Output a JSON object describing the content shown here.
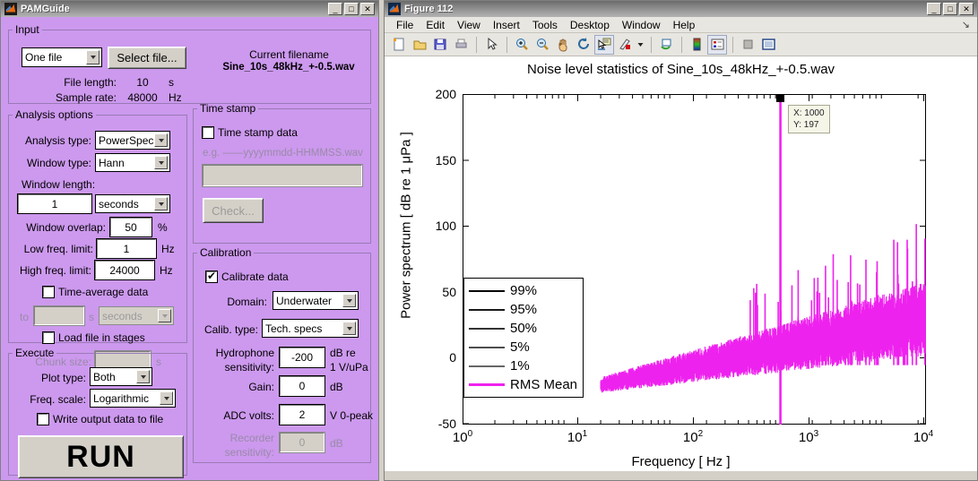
{
  "pamguide": {
    "title": "PAMGuide",
    "icon": "matlab-logo-icon",
    "window_buttons": {
      "minimize": "_",
      "maximize": "□",
      "close": "✕"
    },
    "input": {
      "legend": "Input",
      "file_mode": "One file",
      "select_button": "Select file...",
      "current_filename_label": "Current filename",
      "current_filename": "Sine_10s_48kHz_+-0.5.wav",
      "file_length_label": "File length:",
      "file_length_value": "10",
      "file_length_unit": "s",
      "sample_rate_label": "Sample rate:",
      "sample_rate_value": "48000",
      "sample_rate_unit": "Hz"
    },
    "analysis": {
      "legend": "Analysis options",
      "analysis_type_label": "Analysis type:",
      "analysis_type_value": "PowerSpec",
      "window_type_label": "Window type:",
      "window_type_value": "Hann",
      "window_length_label": "Window length:",
      "window_length_value": "1",
      "window_length_unit": "seconds",
      "window_overlap_label": "Window overlap:",
      "window_overlap_value": "50",
      "window_overlap_unit": "%",
      "low_freq_label": "Low freq. limit:",
      "low_freq_value": "1",
      "low_freq_unit": "Hz",
      "high_freq_label": "High freq. limit:",
      "high_freq_value": "24000",
      "high_freq_unit": "Hz",
      "time_average_label": "Time-average data",
      "time_average_checked": false,
      "time_avg_to_label": "to",
      "time_avg_value": "",
      "time_avg_unit_s": "s",
      "time_avg_unit_value": "seconds",
      "load_stages_label": "Load file in stages",
      "load_stages_checked": false,
      "chunk_size_label": "Chunk size:",
      "chunk_size_value": "",
      "chunk_size_unit": "s"
    },
    "timestamp": {
      "legend": "Time stamp",
      "checkbox_label": "Time stamp data",
      "checked": false,
      "example_text": "e.g. ——yyyymmdd-HHMMSS.wav",
      "field_value": "",
      "check_button": "Check..."
    },
    "calibration": {
      "legend": "Calibration",
      "calibrate_label": "Calibrate data",
      "calibrate_checked": true,
      "domain_label": "Domain:",
      "domain_value": "Underwater",
      "calib_type_label": "Calib. type:",
      "calib_type_value": "Tech. specs",
      "hydrophone_label_1": "Hydrophone",
      "hydrophone_label_2": "sensitivity:",
      "hydrophone_value": "-200",
      "hydrophone_unit_1": "dB re",
      "hydrophone_unit_2": "1 V/uPa",
      "gain_label": "Gain:",
      "gain_value": "0",
      "gain_unit": "dB",
      "adc_label": "ADC volts:",
      "adc_value": "2",
      "adc_unit": "V 0-peak",
      "recorder_label_1": "Recorder",
      "recorder_label_2": "sensitivity:",
      "recorder_value": "0",
      "recorder_unit": "dB"
    },
    "execute": {
      "legend": "Execute",
      "plot_type_label": "Plot type:",
      "plot_type_value": "Both",
      "freq_scale_label": "Freq. scale:",
      "freq_scale_value": "Logarithmic",
      "write_output_label": "Write output data to file",
      "write_output_checked": false,
      "run_button": "RUN"
    }
  },
  "figure": {
    "title": "Figure 112",
    "icon": "matlab-logo-icon",
    "window_buttons": {
      "minimize": "_",
      "maximize": "□",
      "close": "✕"
    },
    "menus": [
      "File",
      "Edit",
      "View",
      "Insert",
      "Tools",
      "Desktop",
      "Window",
      "Help"
    ],
    "dock_glyph": "↘",
    "toolbar": [
      {
        "name": "new-figure-icon",
        "active": false
      },
      {
        "name": "open-file-icon",
        "active": false
      },
      {
        "name": "save-figure-icon",
        "active": false
      },
      {
        "name": "print-figure-icon",
        "active": false
      },
      {
        "name": "sep",
        "active": false
      },
      {
        "name": "pointer-arrow-icon",
        "active": false
      },
      {
        "name": "sep",
        "active": false
      },
      {
        "name": "zoom-in-icon",
        "active": false
      },
      {
        "name": "zoom-out-icon",
        "active": false
      },
      {
        "name": "pan-hand-icon",
        "active": false
      },
      {
        "name": "rotate-3d-icon",
        "active": false
      },
      {
        "name": "data-cursor-icon",
        "active": true
      },
      {
        "name": "brush-data-icon",
        "active": false
      },
      {
        "name": "brush-dropdown-icon",
        "active": false
      },
      {
        "name": "sep",
        "active": false
      },
      {
        "name": "link-plot-icon",
        "active": false
      },
      {
        "name": "sep",
        "active": false
      },
      {
        "name": "colorbar-icon",
        "active": false
      },
      {
        "name": "legend-icon",
        "active": true
      },
      {
        "name": "sep",
        "active": false
      },
      {
        "name": "hide-plot-tools-icon",
        "active": false
      },
      {
        "name": "show-plot-tools-icon",
        "active": false
      }
    ]
  },
  "chart_data": {
    "type": "line",
    "title": "Noise level statistics of Sine_10s_48kHz_+-0.5.wav",
    "xlabel": "Frequency [ Hz ]",
    "ylabel": "Power spectrum [ dB re 1 μPa ]",
    "xscale": "log",
    "yscale": "linear",
    "xlim": [
      1,
      24000
    ],
    "ylim": [
      -50,
      200
    ],
    "yticks": [
      200,
      150,
      100,
      50,
      0,
      -50
    ],
    "xticks": [
      "10^0",
      "10^1",
      "10^2",
      "10^3",
      "10^4"
    ],
    "xtick_labels": [
      "10",
      "10",
      "10",
      "10",
      "10"
    ],
    "xtick_exponents": [
      "0",
      "1",
      "2",
      "3",
      "4"
    ],
    "grid": false,
    "legend_position": "southwest",
    "legend": [
      {
        "label": "99%",
        "color": "#000000"
      },
      {
        "label": "95%",
        "color": "#1a1a1a"
      },
      {
        "label": "50%",
        "color": "#333333"
      },
      {
        "label": "5%",
        "color": "#4d4d4d"
      },
      {
        "label": "1%",
        "color": "#666666"
      },
      {
        "label": "RMS Mean",
        "color": "#ee22ee"
      }
    ],
    "series": [
      {
        "name": "RMS Mean",
        "color": "#ee22ee",
        "description": "Broadband noise floor rising from about -20 dB near 20 Hz to about 30 dB near 24 kHz, with a single narrowband tone peak of 197 dB at 1000 Hz"
      }
    ],
    "annotations": [
      {
        "type": "data-cursor",
        "x": 1000,
        "y": 197,
        "x_text": "X: 1000",
        "y_text": "Y: 197"
      }
    ],
    "peak": {
      "frequency_hz": 1000,
      "level_db": 197
    }
  }
}
